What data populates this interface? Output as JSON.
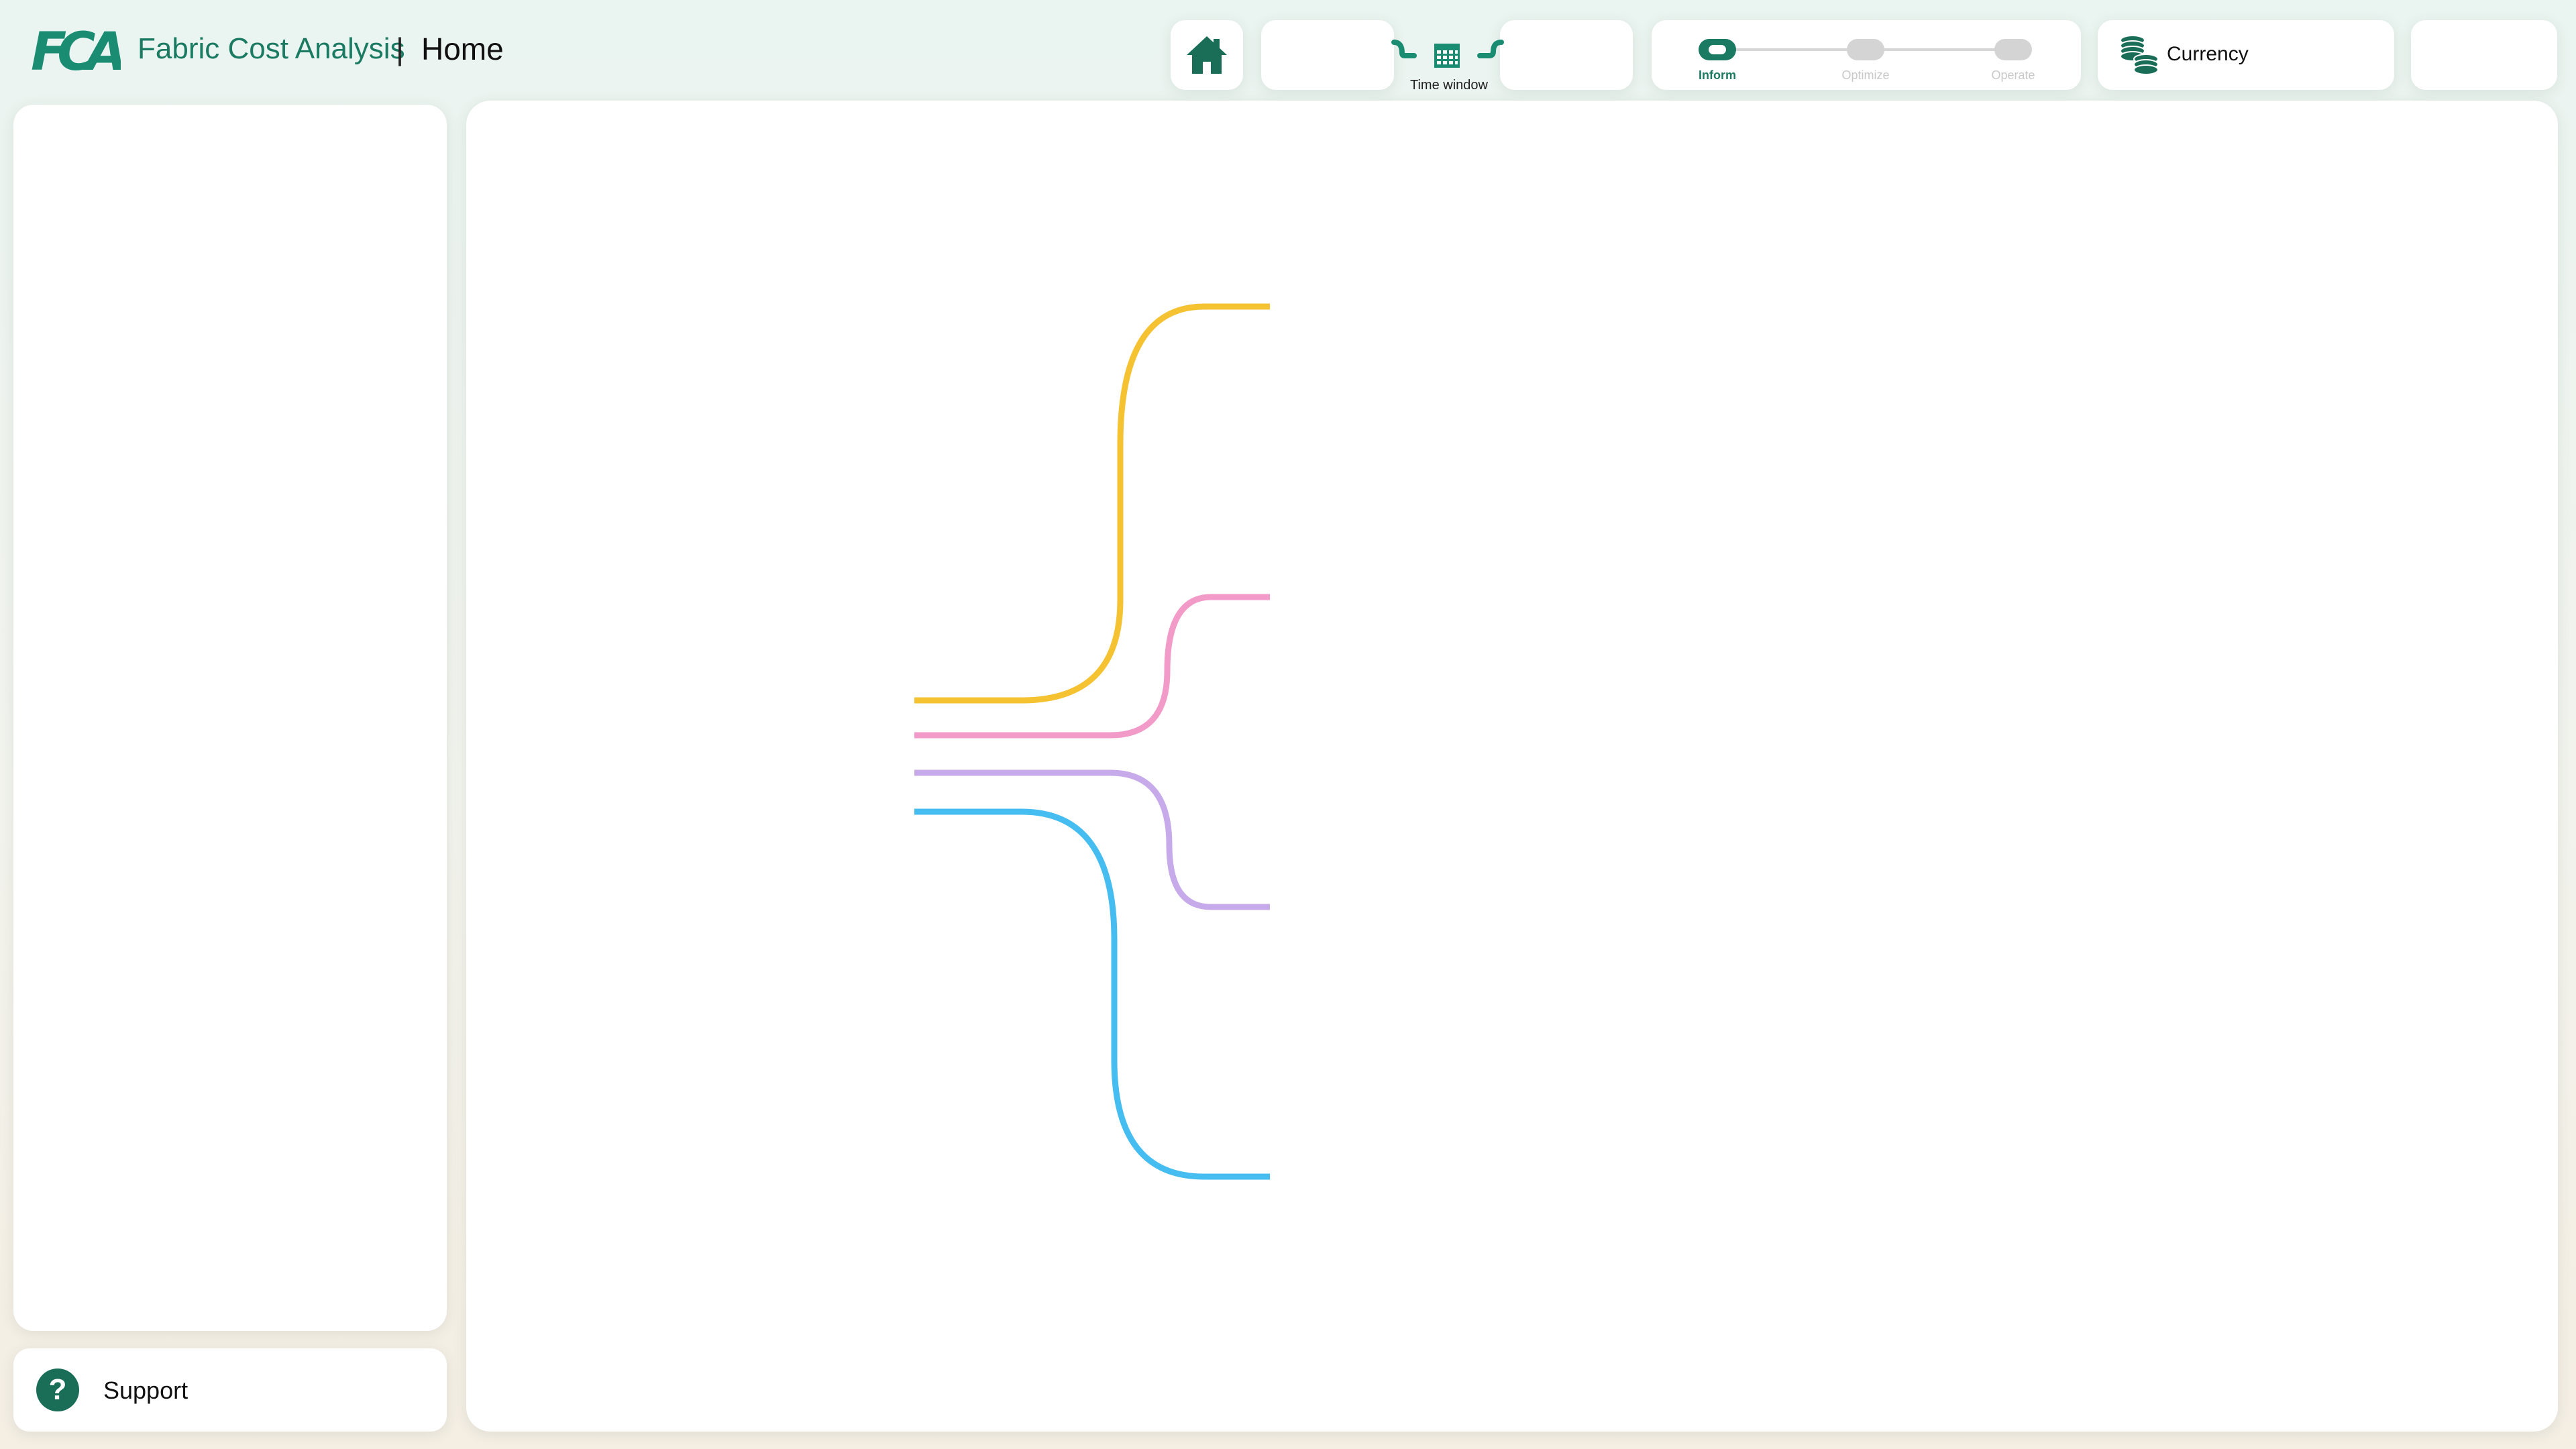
{
  "header": {
    "app_title": "Fabric Cost Analysis",
    "title_separator": "|",
    "page_title": "Home",
    "logo_text": "FCA"
  },
  "toolbar": {
    "home_icon": "home-icon",
    "time_window_label": "Time window",
    "time_window_icon": "calendar-icon",
    "phases": [
      {
        "label": "Inform",
        "active": true
      },
      {
        "label": "Optimize",
        "active": false
      },
      {
        "label": "Operate",
        "active": false
      }
    ],
    "currency_label": "Currency",
    "currency_icon": "coins-icon"
  },
  "sidebar": {
    "support_label": "Support",
    "support_icon": "question-icon"
  },
  "main": {
    "tree_branch_colors": [
      "#f5c232",
      "#f29ac8",
      "#c7aaea",
      "#45bdf0"
    ]
  },
  "colors": {
    "accent": "#1a7a62",
    "inactive": "#d4d4d4"
  }
}
